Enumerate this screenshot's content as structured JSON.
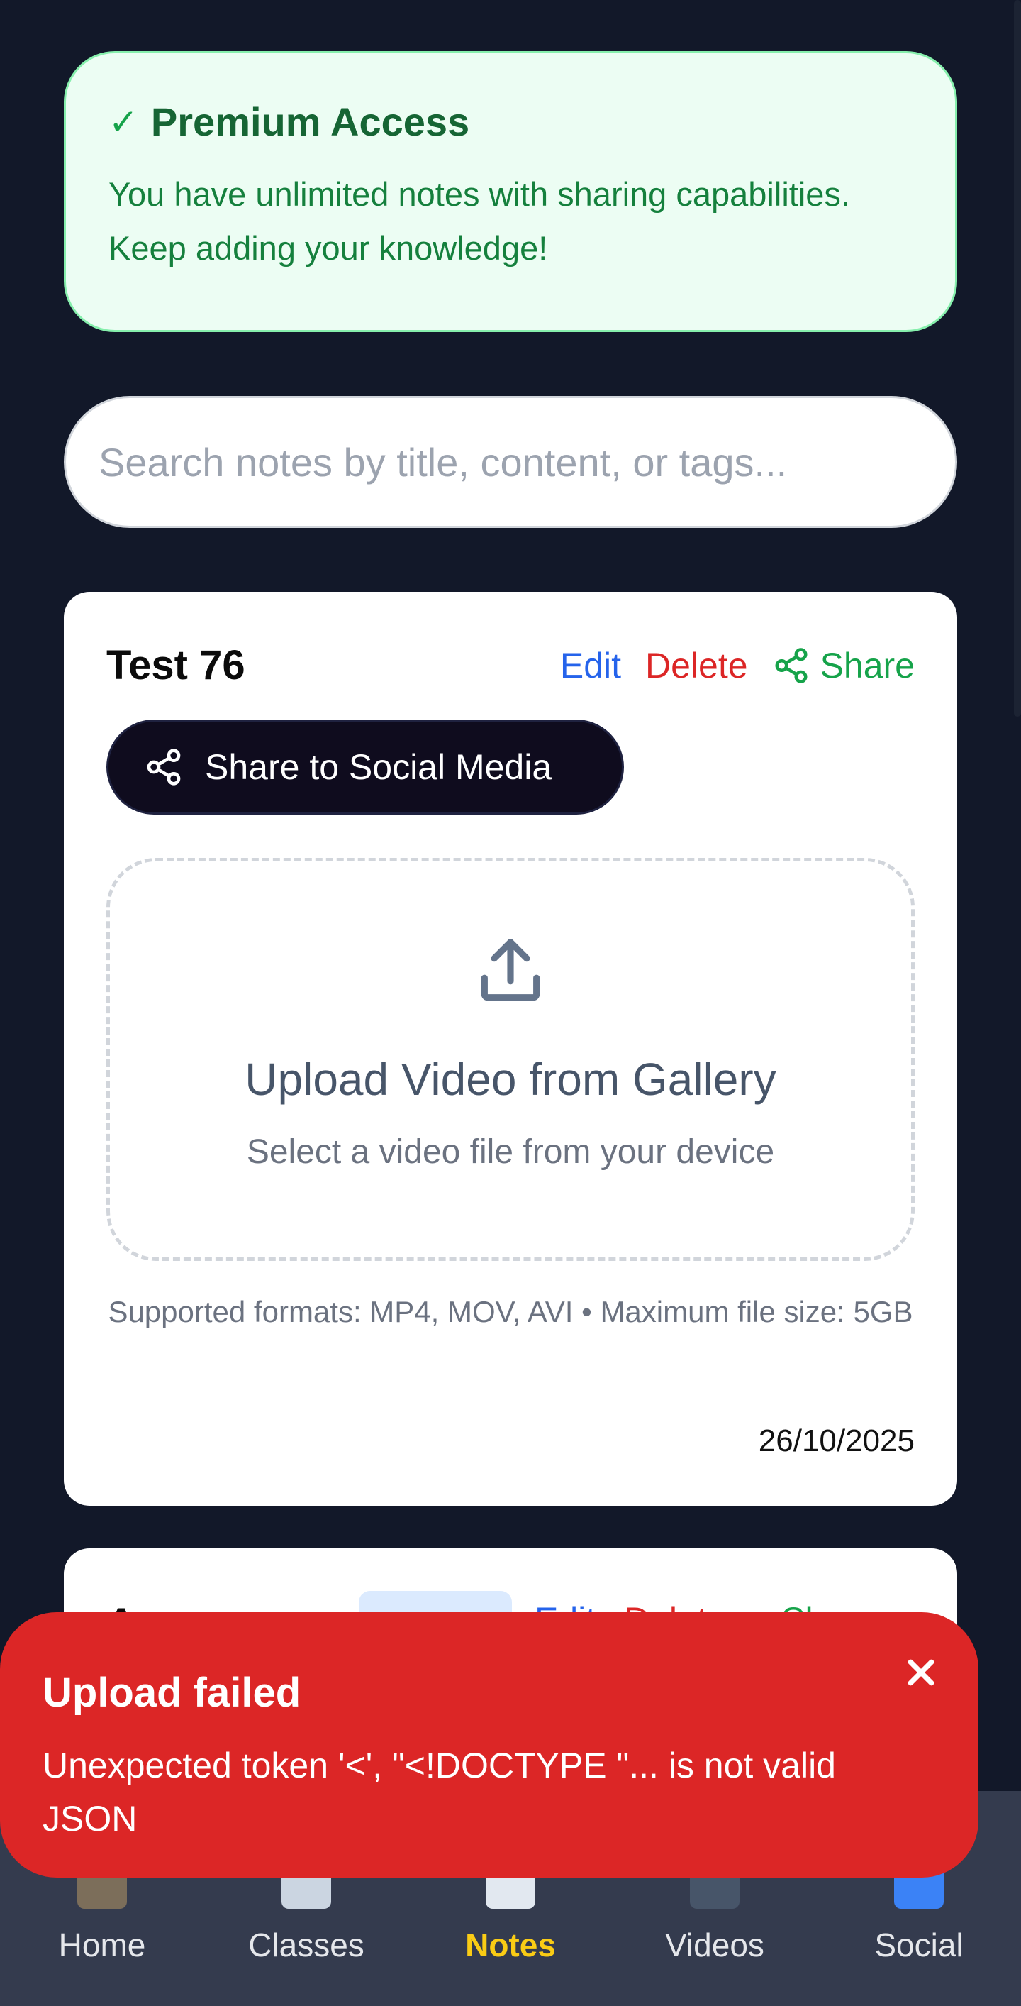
{
  "premium": {
    "check_glyph": "✓",
    "title": "Premium Access",
    "text": "You have unlimited notes with sharing capabilities. Keep adding your knowledge!"
  },
  "search": {
    "placeholder": "Search notes by title, content, or tags...",
    "value": ""
  },
  "note": {
    "title": "Test 76",
    "edit_label": "Edit",
    "delete_label": "Delete",
    "share_label": "Share",
    "social_button_label": "Share to Social Media",
    "upload_title": "Upload Video from Gallery",
    "upload_subtitle": "Select a video file from your device",
    "formats_text": "Supported formats: MP4, MOV, AVI • Maximum file size: 5GB",
    "date": "26/10/2025"
  },
  "note2": {
    "title_partial": "A",
    "edit_label": "Edit",
    "delete_label": "Delete",
    "share_label": "Share"
  },
  "toast": {
    "title": "Upload failed",
    "message": "Unexpected token '<', \"<!DOCTYPE \"... is not valid JSON",
    "close_glyph": "✕"
  },
  "bottom_nav": {
    "items": [
      {
        "label": "Home",
        "icon": "home-icon"
      },
      {
        "label": "Classes",
        "icon": "calendar-icon"
      },
      {
        "label": "Notes",
        "icon": "notes-icon",
        "active": true
      },
      {
        "label": "Videos",
        "icon": "tv-icon"
      },
      {
        "label": "Social",
        "icon": "people-icon"
      }
    ]
  },
  "colors": {
    "background": "#121829",
    "premium_bg": "#ecfdf3",
    "premium_text": "#15803d",
    "edit": "#2563eb",
    "delete": "#dc2626",
    "share": "#16a34a",
    "toast_bg": "#dc2626",
    "nav_bg": "#343b4e",
    "nav_active": "#facc15"
  }
}
